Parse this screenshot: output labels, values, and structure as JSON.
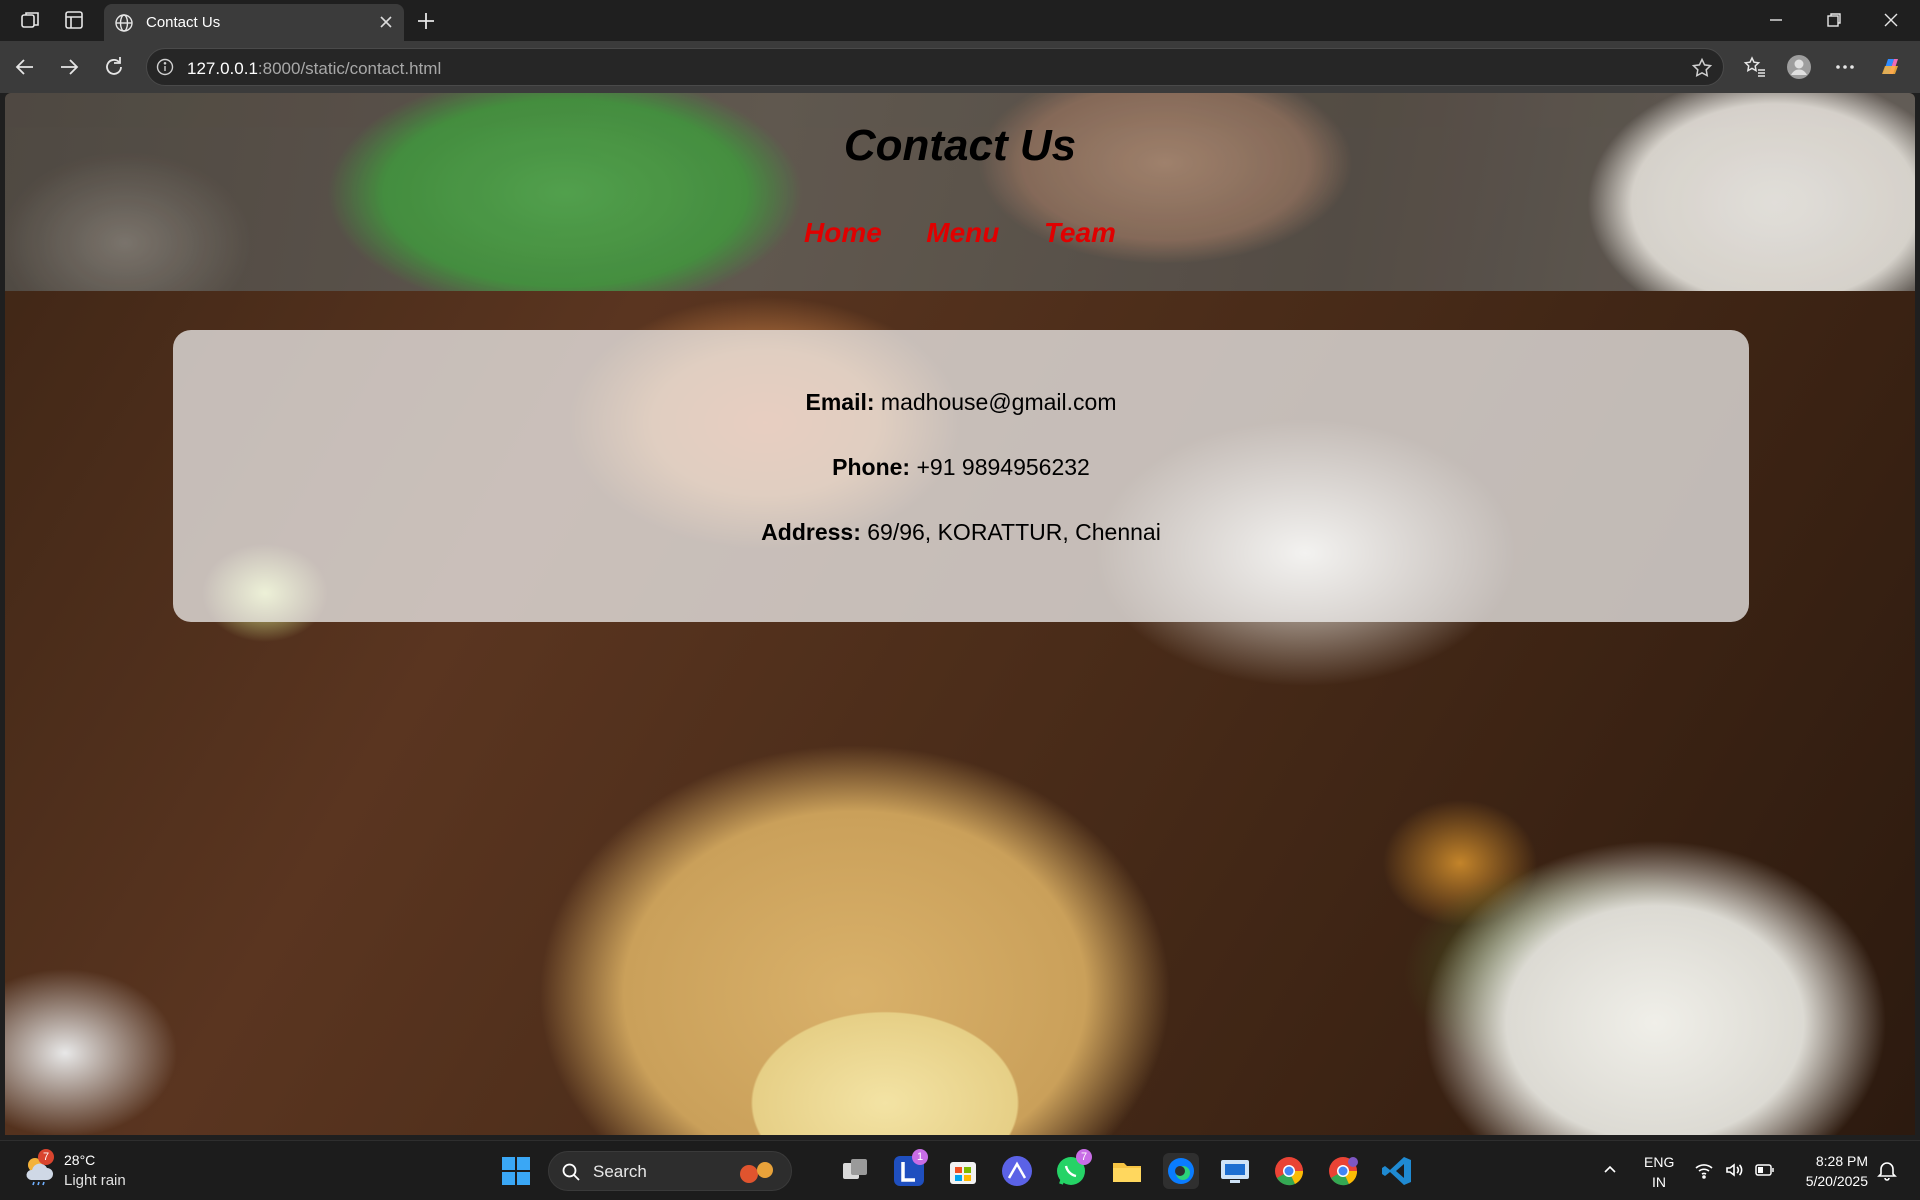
{
  "browser": {
    "tab_title": "Contact Us",
    "url_host": "127.0.0.1",
    "url_rest": ":8000/static/contact.html"
  },
  "page": {
    "title": "Contact Us",
    "nav": [
      "Home",
      "Menu",
      "Team"
    ],
    "contact": {
      "email_label": "Email:",
      "email_value": "madhouse@gmail.com",
      "phone_label": "Phone:",
      "phone_value": "+91 9894956232",
      "address_label": "Address:",
      "address_value": "69/96, KORATTUR, Chennai"
    }
  },
  "taskbar": {
    "weather_temp": "28°C",
    "weather_desc": "Light rain",
    "weather_badge": "7",
    "search_label": "Search",
    "lens_badge": "1",
    "whatsapp_badge": "7",
    "lang_top": "ENG",
    "lang_bottom": "IN",
    "time": "8:28 PM",
    "date": "5/20/2025"
  },
  "colors": {
    "nav_link": "#e00000",
    "edge_accent": "#0a7cff"
  }
}
